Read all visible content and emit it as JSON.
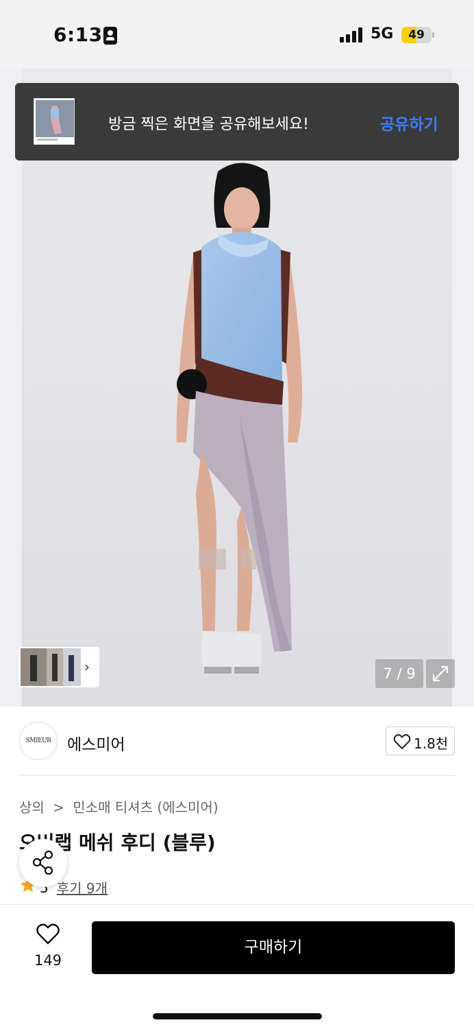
{
  "status_bar": {
    "time": "6:13",
    "network": "5G",
    "battery": "49",
    "battery_level": 0.49,
    "icons": [
      "portrait-lock-icon",
      "signal-icon",
      "battery-icon"
    ]
  },
  "toast": {
    "message": "방금 찍은 화면을 공유해보세요!",
    "action": "공유하기",
    "action_color": "#3b7cff"
  },
  "gallery": {
    "counter": "7 / 9",
    "icons": [
      "chevron-right-icon",
      "expand-icon"
    ]
  },
  "brand": {
    "logo_text": "SMIEUR",
    "name": "에스미어",
    "likes": "1.8천"
  },
  "product": {
    "breadcrumb": [
      "상의",
      ">",
      "민소매 티셔츠 (에스미어)"
    ],
    "title": "오버랩 메쉬 후디 (블루)",
    "rating": "5",
    "reviews": "후기 9개",
    "star_color": "#f5a623"
  },
  "bottom_bar": {
    "wish_count": "149",
    "buy_label": "구매하기"
  }
}
